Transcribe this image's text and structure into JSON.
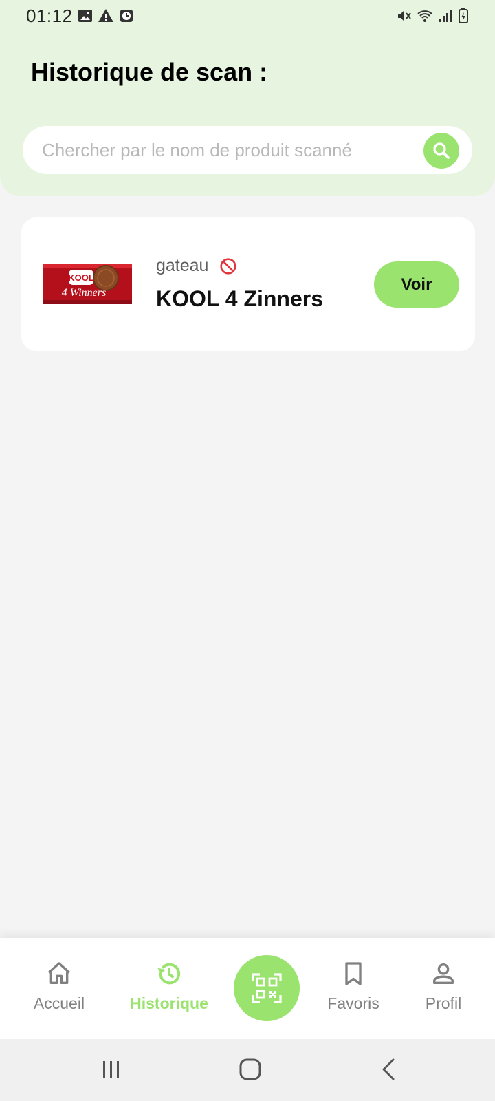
{
  "status_bar": {
    "time": "01:12",
    "left_icons": [
      "image-icon",
      "warning-icon",
      "alarm-icon"
    ],
    "right_icons": [
      "mute-icon",
      "wifi-icon",
      "signal-icon",
      "battery-icon"
    ]
  },
  "header": {
    "title": "Historique de scan :"
  },
  "search": {
    "placeholder": "Chercher par le nom de produit scanné",
    "icon": "search-icon"
  },
  "history": [
    {
      "category": "gateau",
      "status_icon": "ban-icon",
      "product_name": "KOOL 4 Zinners",
      "image": "product-image",
      "image_text": {
        "brand": "KOOL",
        "subtitle": "4 Winners"
      },
      "action_label": "Voir"
    }
  ],
  "bottom_nav": {
    "items": [
      {
        "label": "Accueil",
        "icon": "home-icon",
        "active": false
      },
      {
        "label": "Historique",
        "icon": "history-icon",
        "active": true
      },
      {
        "label": "Favoris",
        "icon": "bookmark-icon",
        "active": false
      },
      {
        "label": "Profil",
        "icon": "profile-icon",
        "active": false
      }
    ],
    "scan_icon": "qr-code-icon"
  },
  "system_nav": [
    "recents-icon",
    "home-button-icon",
    "back-icon"
  ],
  "colors": {
    "accent": "#9be36f",
    "header_bg": "#e6f4e0",
    "page_bg": "#f4f4f4",
    "ban": "#e0383e",
    "inactive": "#808080"
  }
}
